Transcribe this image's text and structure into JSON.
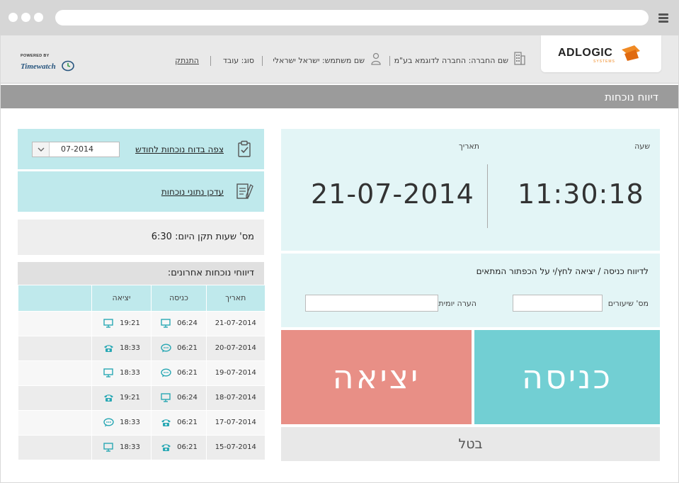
{
  "header": {
    "brand": "ADLOGIC",
    "brand_sub": "SYSTEMS",
    "company": "שם החברה: החברה לדוגמא בע\"מ",
    "username": "שם משתמש: ישראל ישראלי",
    "user_type": "סוג: עובד",
    "logout": "התנתק",
    "powered_by": "POWERED BY",
    "timewatch": "Timewatch"
  },
  "page_title": "דיווח נוכחות",
  "clock": {
    "time_label": "שעה",
    "time_value": "11:30:18",
    "date_label": "תאריך",
    "date_value": "21-07-2014"
  },
  "form": {
    "instruction": "לדיווח כניסה / יציאה לחץ/י על הכפתור המתאים",
    "lessons_label": "מס' שיעורים",
    "lessons_value": "",
    "note_label": "הערה יומית",
    "note_value": ""
  },
  "buttons": {
    "enter": "כניסה",
    "exit": "יציאה",
    "cancel": "בטל"
  },
  "sidebar": {
    "view_report": "צפה בדוח נוכחות לחודש",
    "month_value": "07-2014",
    "update_data": "עדכן נתוני נוכחות",
    "standard_hours": "מס' שעות תקן היום: 6:30",
    "recent_title": "דיווחי נוכחות אחרונים:"
  },
  "table": {
    "col_date": "תאריך",
    "col_in": "כניסה",
    "col_out": "יציאה",
    "rows": [
      {
        "date": "21-07-2014",
        "in": "06:24",
        "in_icon": "monitor-icon",
        "out": "19:21",
        "out_icon": "monitor-icon"
      },
      {
        "date": "20-07-2014",
        "in": "06:21",
        "in_icon": "chat-icon",
        "out": "18:33",
        "out_icon": "phone-icon"
      },
      {
        "date": "19-07-2014",
        "in": "06:21",
        "in_icon": "chat-icon",
        "out": "18:33",
        "out_icon": "monitor-icon"
      },
      {
        "date": "18-07-2014",
        "in": "06:24",
        "in_icon": "monitor-icon",
        "out": "19:21",
        "out_icon": "phone-icon"
      },
      {
        "date": "17-07-2014",
        "in": "06:21",
        "in_icon": "phone-icon",
        "out": "18:33",
        "out_icon": "chat-icon"
      },
      {
        "date": "15-07-2014",
        "in": "06:21",
        "in_icon": "phone-icon",
        "out": "18:33",
        "out_icon": "monitor-icon"
      }
    ]
  },
  "colors": {
    "accent": "#72cfd3",
    "exit": "#e88f86",
    "panel": "#e3f5f6",
    "icon": "#2aa8b4",
    "brand_orange": "#f08a24"
  }
}
